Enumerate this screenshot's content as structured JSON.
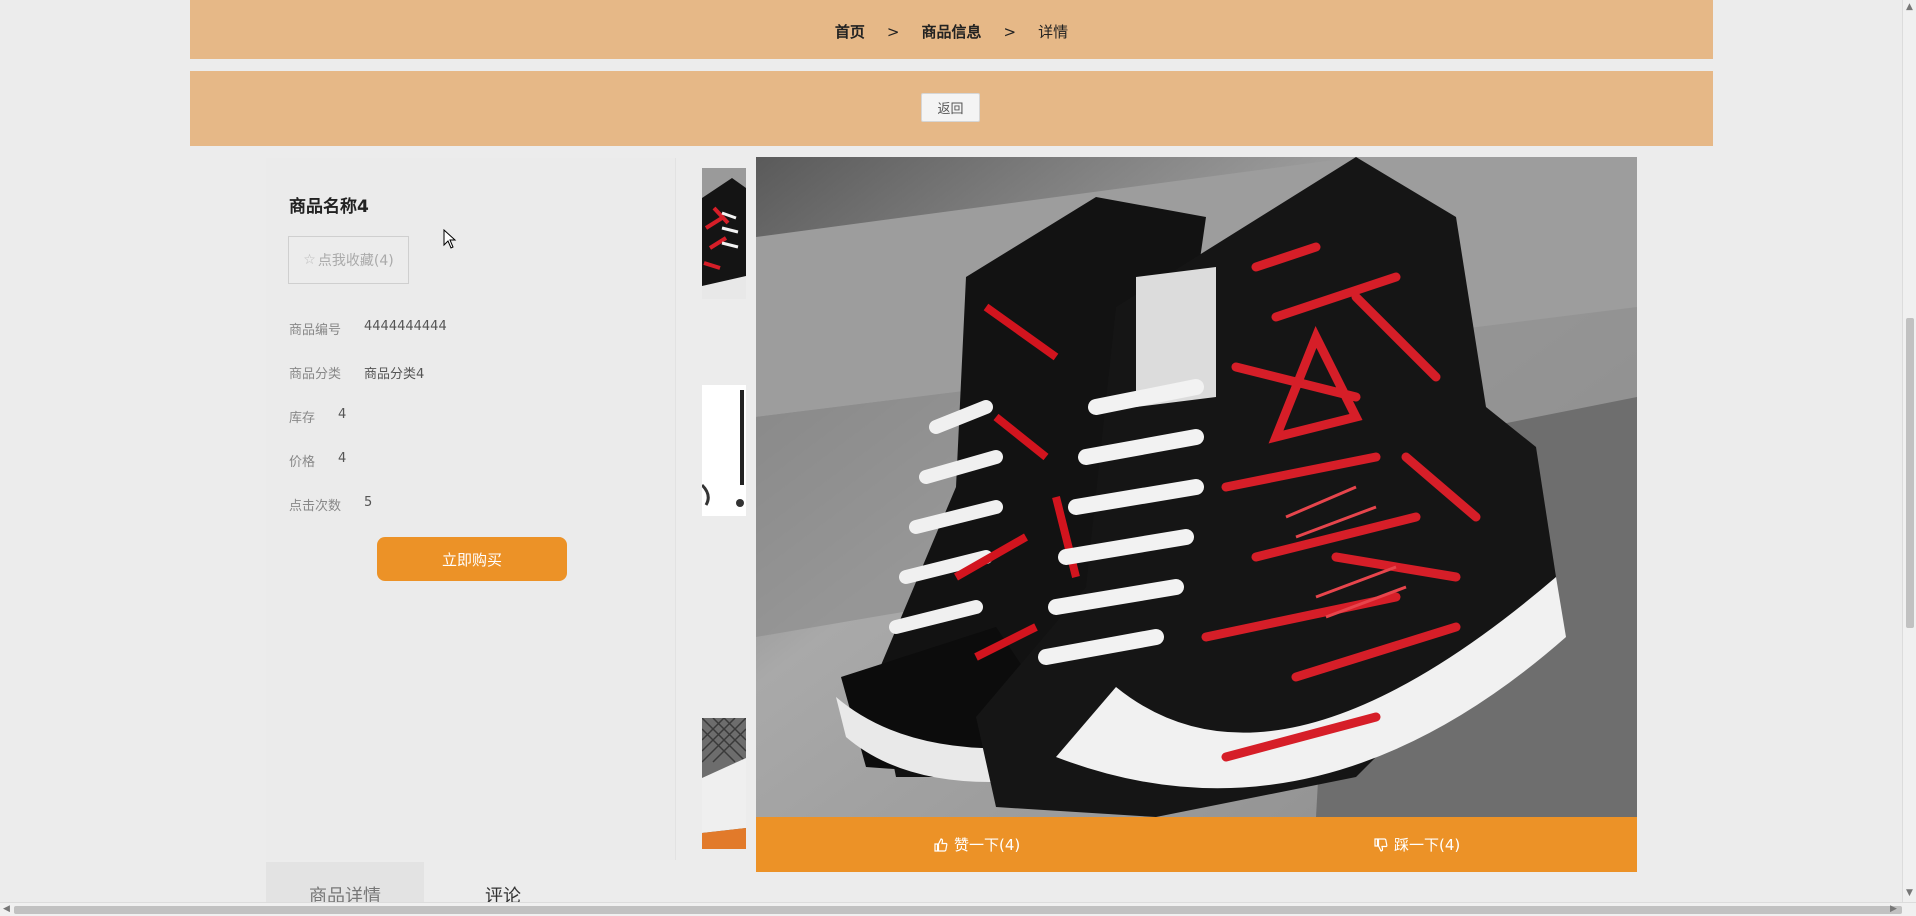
{
  "breadcrumb": {
    "home": "首页",
    "sep1": ">",
    "category": "商品信息",
    "sep2": ">",
    "current": "详情"
  },
  "actions": {
    "back_label": "返回"
  },
  "product": {
    "name": "商品名称4",
    "favorite_label": "点我收藏(4)",
    "fields": [
      {
        "key": "商品编号",
        "value": "4444444444"
      },
      {
        "key": "商品分类",
        "value": "商品分类4"
      },
      {
        "key": "库存",
        "value": "4"
      },
      {
        "key": "价格",
        "value": "4"
      },
      {
        "key": "点击次数",
        "value": "5"
      }
    ],
    "buy_label": "立即购买"
  },
  "votes": {
    "like_label": "赞一下(4)",
    "dislike_label": "踩一下(4)"
  },
  "tabs": [
    {
      "label": "商品详情"
    },
    {
      "label": "评论"
    }
  ],
  "colors": {
    "bar": "#e6b887",
    "accent": "#ec9227"
  },
  "icons": {
    "favorite": "star-outline-icon",
    "like": "thumbs-up-icon",
    "dislike": "thumbs-down-icon"
  }
}
